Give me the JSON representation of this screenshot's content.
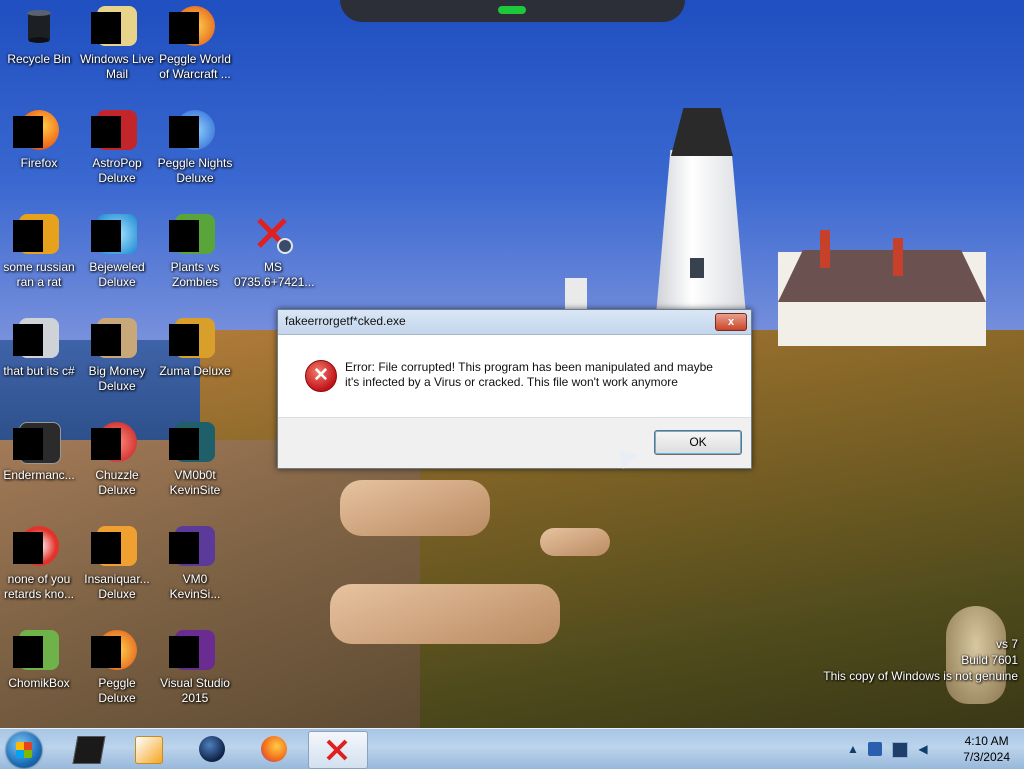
{
  "desktop": {
    "icons": [
      {
        "label": "Recycle Bin",
        "icon": "recycle-bin-icon"
      },
      {
        "label": "Windows Live Mail",
        "icon": "windows-live-mail-icon"
      },
      {
        "label": "Peggle World of Warcraft ...",
        "icon": "peggle-wow-icon"
      },
      {
        "label": "Firefox",
        "icon": "firefox-icon"
      },
      {
        "label": "AstroPop Deluxe",
        "icon": "astropop-icon"
      },
      {
        "label": "Peggle Nights Deluxe",
        "icon": "peggle-nights-icon"
      },
      {
        "label": "some russian ran a rat",
        "icon": "app-icon"
      },
      {
        "label": "Bejeweled Deluxe",
        "icon": "bejeweled-icon"
      },
      {
        "label": "Plants vs Zombies",
        "icon": "plants-vs-zombies-icon"
      },
      {
        "label": "MS 0735.6+7421...",
        "icon": "broken-shortcut-icon"
      },
      {
        "label": "that but its c#",
        "icon": "app-icon"
      },
      {
        "label": "Big Money Deluxe",
        "icon": "big-money-icon"
      },
      {
        "label": "Zuma Deluxe",
        "icon": "zuma-icon"
      },
      {
        "label": "Endermanc...",
        "icon": "app-icon"
      },
      {
        "label": "Chuzzle Deluxe",
        "icon": "chuzzle-icon"
      },
      {
        "label": "VM0b0t KevinSite",
        "icon": "app-icon"
      },
      {
        "label": "none of you retards kno...",
        "icon": "app-icon"
      },
      {
        "label": "Insaniquar... Deluxe",
        "icon": "insaniquarium-icon"
      },
      {
        "label": "VM0 KevinSi...",
        "icon": "app-icon"
      },
      {
        "label": "ChomikBox",
        "icon": "chomikbox-icon"
      },
      {
        "label": "Peggle Deluxe",
        "icon": "peggle-icon"
      },
      {
        "label": "Visual Studio 2015",
        "icon": "visual-studio-icon"
      }
    ]
  },
  "dialog": {
    "title": "fakeerrorgetf*cked.exe",
    "close_label": "x",
    "message": "Error: File corrupted! This program has been manipulated and maybe it's infected by a Virus or cracked. This file won't work anymore",
    "ok_label": "OK",
    "icon": "error-icon"
  },
  "watermark": {
    "line1": "vs 7",
    "line2": "Build 7601",
    "line3": "This copy of Windows is not genuine"
  },
  "taskbar": {
    "items": [
      {
        "name": "start-button",
        "icon": "windows-orb-icon"
      },
      {
        "name": "taskbar-app-1",
        "icon": "black-box-icon"
      },
      {
        "name": "taskbar-media-player",
        "icon": "media-player-icon"
      },
      {
        "name": "taskbar-app-globe",
        "icon": "globe-icon"
      },
      {
        "name": "taskbar-firefox",
        "icon": "firefox-icon"
      },
      {
        "name": "taskbar-error-app",
        "icon": "red-x-icon"
      }
    ],
    "clock": {
      "time": "4:10 AM",
      "date": "7/3/2024"
    },
    "tray_icons": [
      "show-hidden-icons-arrow",
      "flag-icon",
      "monitor-icon",
      "volume-icon"
    ]
  }
}
